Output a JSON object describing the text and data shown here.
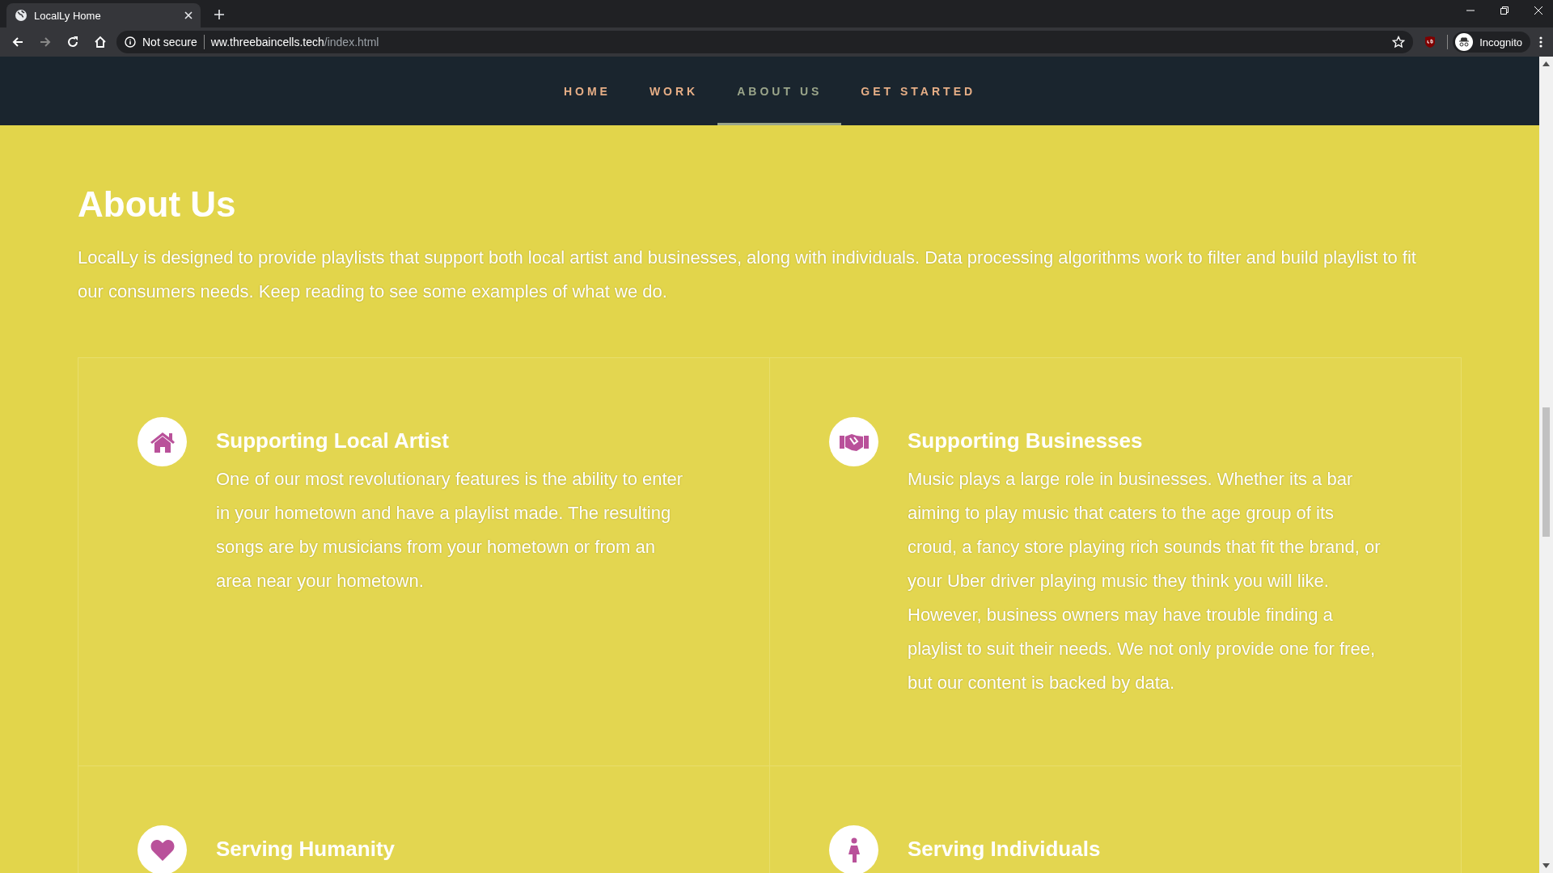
{
  "browser": {
    "tab_title": "LocalLy Home",
    "security": "Not secure",
    "url_host": "ww.threebaincells.tech",
    "url_path": "/index.html",
    "profile": "Incognito"
  },
  "nav": [
    {
      "label": "HOME",
      "selected": false
    },
    {
      "label": "WORK",
      "selected": false
    },
    {
      "label": "ABOUT US",
      "selected": true
    },
    {
      "label": "GET STARTED",
      "selected": false
    }
  ],
  "about": {
    "heading": "About Us",
    "intro": "LocalLy is designed to provide playlists that support both local artist and businesses, along with individuals. Data processing algorithms work to filter and build playlist to fit our consumers needs. Keep reading to see some examples of what we do.",
    "features": [
      {
        "title": "Supporting Local Artist",
        "body": "One of our most revolutionary features is the ability to enter in your hometown and have a playlist made. The resulting songs are by musicians from your hometown or from an area near your hometown."
      },
      {
        "title": "Supporting Businesses",
        "body": "Music plays a large role in businesses. Whether its a bar aiming to play music that caters to the age group of its croud, a fancy store playing rich sounds that fit the brand, or your Uber driver playing music they think you will like. However, business owners may have trouble finding a playlist to suit their needs. We not only provide one for free, but our content is backed by data."
      },
      {
        "title": "Serving Humanity"
      },
      {
        "title": "Serving Individuals"
      }
    ]
  }
}
